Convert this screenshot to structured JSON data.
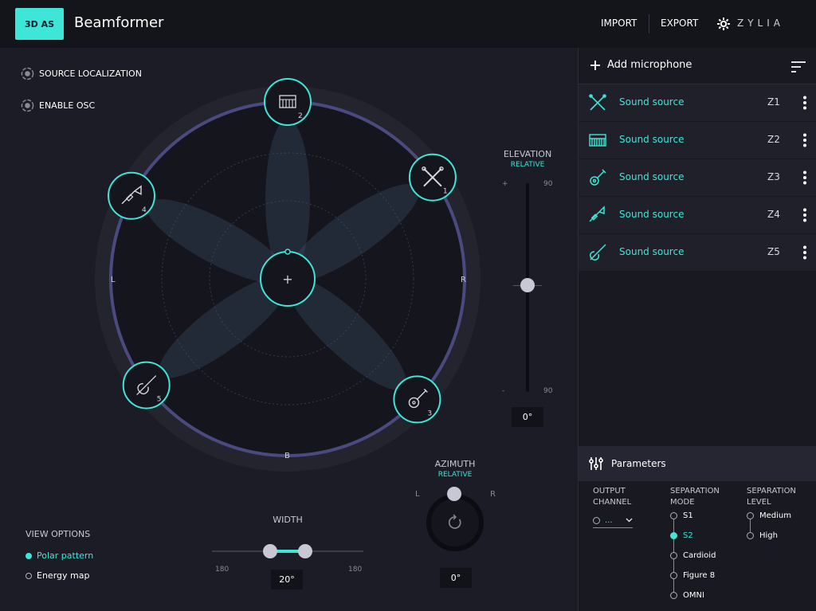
{
  "topbar": {
    "badge": "3D AS",
    "title": "Beamformer",
    "import_label": "IMPORT",
    "export_label": "EXPORT",
    "brand": "ZYLIA"
  },
  "toggles": {
    "source_localization": "SOURCE LOCALIZATION",
    "enable_osc": "ENABLE OSC"
  },
  "polar": {
    "left_label": "L",
    "right_label": "R",
    "back_label": "B",
    "center_symbol": "+",
    "sources": [
      {
        "number": "2",
        "icon": "piano-icon",
        "angle_deg": 0
      },
      {
        "number": "1",
        "icon": "drumsticks-icon",
        "angle_deg": 55
      },
      {
        "number": "3",
        "icon": "guitar-icon",
        "angle_deg": 133
      },
      {
        "number": "5",
        "icon": "violin-icon",
        "angle_deg": 233
      },
      {
        "number": "4",
        "icon": "trumpet-icon",
        "angle_deg": 298
      }
    ]
  },
  "elevation": {
    "label": "ELEVATION",
    "mode": "RELATIVE",
    "top_sign": "+",
    "bottom_sign": "-",
    "top_value": "90",
    "bottom_value": "90",
    "value": "0°",
    "level": 0.5
  },
  "azimuth": {
    "label": "AZIMUTH",
    "mode": "RELATIVE",
    "left": "L",
    "right": "R",
    "value": "0°"
  },
  "width": {
    "label": "WIDTH",
    "min_label": "180",
    "max_label": "180",
    "value": "20°"
  },
  "view_options": {
    "title": "VIEW OPTIONS",
    "options": [
      {
        "label": "Polar pattern",
        "selected": true
      },
      {
        "label": "Energy map",
        "selected": false
      }
    ]
  },
  "sidebar": {
    "add_label": "Add microphone",
    "sources": [
      {
        "name": "Sound source",
        "zone": "Z1",
        "icon": "drumsticks-icon"
      },
      {
        "name": "Sound source",
        "zone": "Z2",
        "icon": "piano-icon"
      },
      {
        "name": "Sound source",
        "zone": "Z3",
        "icon": "guitar-icon"
      },
      {
        "name": "Sound source",
        "zone": "Z4",
        "icon": "trumpet-icon"
      },
      {
        "name": "Sound source",
        "zone": "Z5",
        "icon": "violin-icon"
      }
    ]
  },
  "parameters": {
    "title": "Parameters",
    "output_channel": {
      "label_line1": "OUTPUT",
      "label_line2": "CHANNEL",
      "value": "..."
    },
    "separation_mode": {
      "label_line1": "SEPARATION",
      "label_line2": "MODE",
      "options": [
        "S1",
        "S2",
        "Cardioid",
        "Figure 8",
        "OMNI"
      ],
      "selected": "S2"
    },
    "separation_level": {
      "label_line1": "SEPARATION",
      "label_line2": "LEVEL",
      "options": [
        "Medium",
        "High"
      ]
    }
  },
  "colors": {
    "accent": "#3ee6d8",
    "background": "#1c1c26",
    "topbar": "#14141b",
    "ring": "#4a4a80"
  }
}
